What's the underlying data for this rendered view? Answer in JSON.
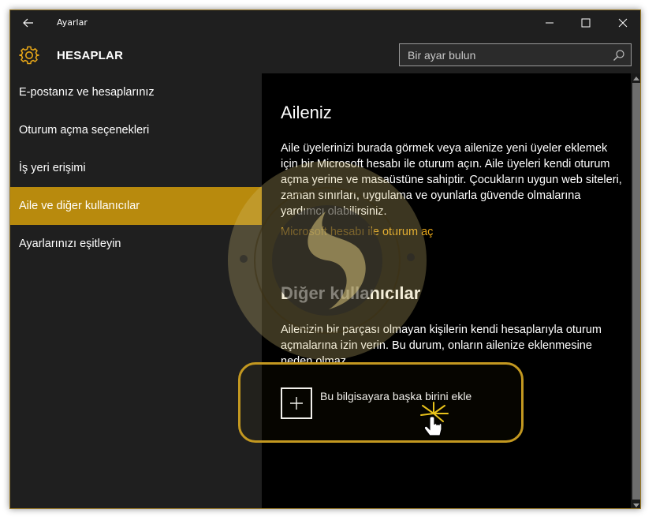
{
  "window": {
    "title": "Ayarlar"
  },
  "header": {
    "title": "HESAPLAR",
    "search_placeholder": "Bir ayar bulun"
  },
  "sidebar": {
    "items": [
      {
        "label": "E-postanız ve hesaplarınız",
        "active": false
      },
      {
        "label": "Oturum açma seçenekleri",
        "active": false
      },
      {
        "label": "İş yeri erişimi",
        "active": false
      },
      {
        "label": "Aile ve diğer kullanıcılar",
        "active": true
      },
      {
        "label": "Ayarlarınızı eşitleyin",
        "active": false
      }
    ]
  },
  "main": {
    "family_heading": "Aileniz",
    "family_description": "Aile üyelerinizi burada görmek veya ailenize yeni üyeler eklemek için bir Microsoft hesabı ile oturum açın. Aile üyeleri kendi oturum açma yerine ve masaüstüne sahiptir. Çocukların uygun web siteleri, zaman sınırları, uygulama ve oyunlarla güvende olmalarına yardımcı olabilirsiniz.",
    "signin_link": "Microsoft hesabı ile oturum aç",
    "others_heading": "Diğer kullanıcılar",
    "others_description": "Ailenizin bir parçası olmayan kişilerin kendi hesaplarıyla oturum açmalarına izin verin. Bu durum, onların ailenize eklenmesine neden olmaz.",
    "add_user_label": "Bu bilgisayara başka birini ekle"
  },
  "colors": {
    "accent": "#b88a0d",
    "link": "#e8a718",
    "sidebar_bg": "#1f1f1f",
    "content_bg": "#000000"
  },
  "icons": {
    "back": "back-arrow-icon",
    "minimize": "minimize-icon",
    "maximize": "maximize-icon",
    "close": "close-icon",
    "settings": "gear-icon",
    "search": "search-icon",
    "add": "plus-icon"
  }
}
